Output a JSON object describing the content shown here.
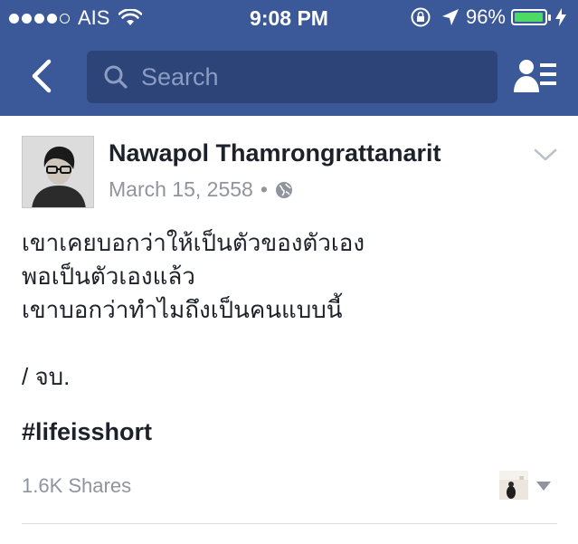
{
  "status_bar": {
    "carrier": "AIS",
    "time": "9:08 PM",
    "battery_percent": "96%",
    "battery_level": 0.96,
    "signal_bars_filled": 4,
    "signal_bars_total": 5
  },
  "nav": {
    "back_icon": "chevron-left-icon",
    "search_placeholder": "Search",
    "friends_icon": "friend-requests-icon"
  },
  "post": {
    "author": "Nawapol Thamrongrattanarit",
    "date": "March 15, 2558",
    "separator": "•",
    "privacy_icon": "globe-icon",
    "body_lines": [
      "เขาเคยบอกว่าให้เป็นตัวของตัวเอง",
      "พอเป็นตัวเองแล้ว",
      "เขาบอกว่าทำไมถึงเป็นคนแบบนี้",
      "",
      "/ จบ."
    ],
    "hashtag": "#lifeisshort",
    "shares": "1.6K Shares"
  },
  "colors": {
    "header_bg": "#3b5998",
    "search_bg": "#2c4478",
    "battery_fill": "#4cd964",
    "meta_text": "#90949c"
  }
}
